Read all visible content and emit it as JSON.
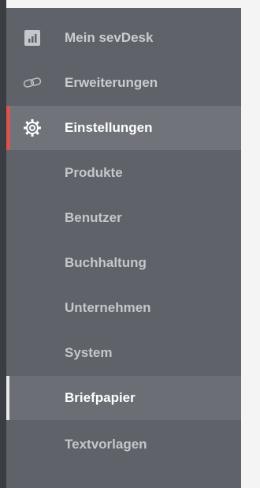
{
  "sidebar": {
    "items": [
      {
        "label": "Mein sevDesk",
        "icon": "bar-chart-icon"
      },
      {
        "label": "Erweiterungen",
        "icon": "link-icon"
      },
      {
        "label": "Einstellungen",
        "icon": "gear-icon"
      }
    ],
    "subitems": [
      {
        "label": "Produkte"
      },
      {
        "label": "Benutzer"
      },
      {
        "label": "Buchhaltung"
      },
      {
        "label": "Unternehmen"
      },
      {
        "label": "System"
      },
      {
        "label": "Briefpapier"
      },
      {
        "label": "Textvorlagen"
      }
    ]
  },
  "colors": {
    "sidebar_bg": "#5f6369",
    "active_accent": "#d9534f",
    "text": "#c9ccd0"
  }
}
